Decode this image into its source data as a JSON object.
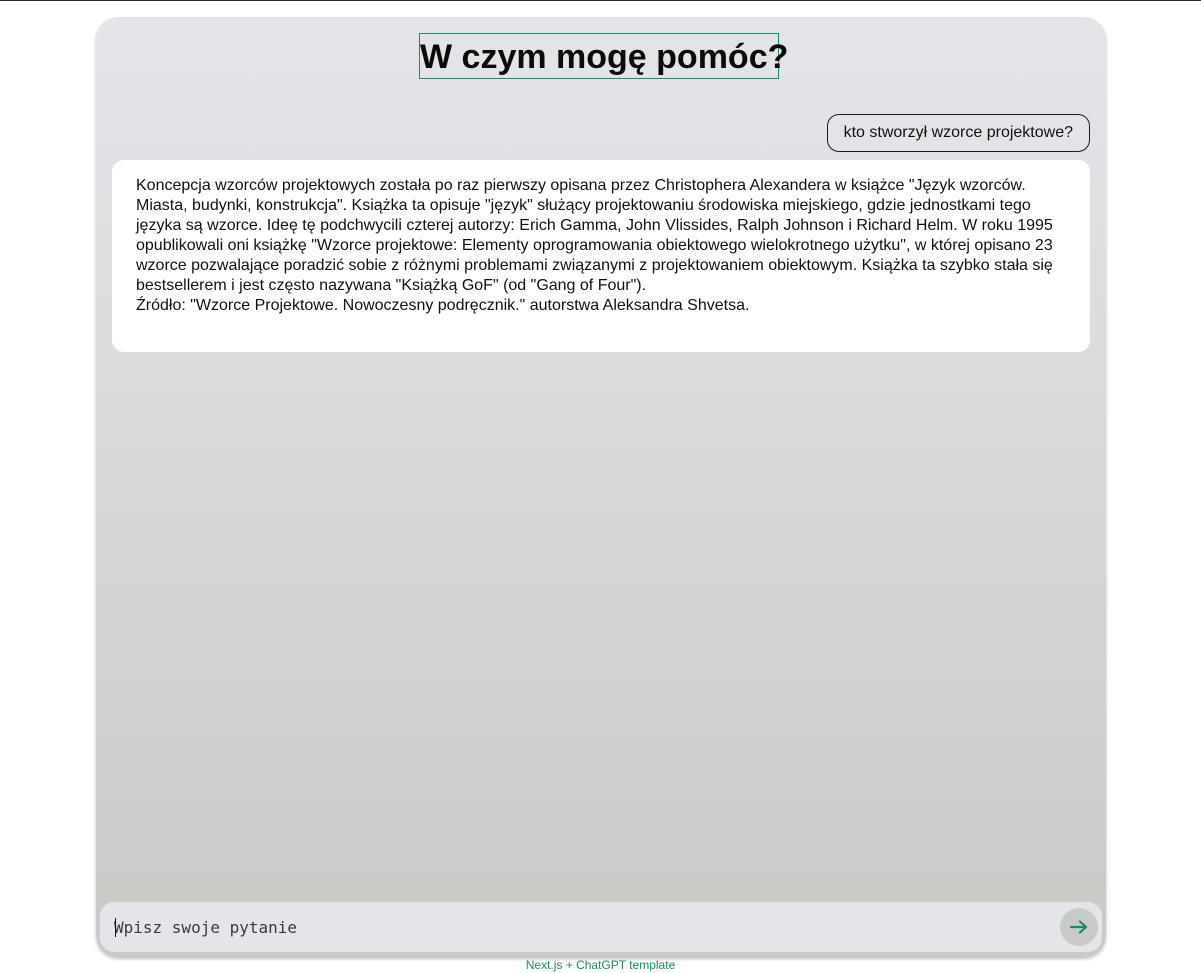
{
  "header": {
    "title": "W czym mogę pomóc?"
  },
  "conversation": {
    "user_message": "kto stworzył wzorce projektowe?",
    "assistant_message": {
      "paragraph": "Koncepcja wzorców projektowych została po raz pierwszy opisana przez Christophera Alexandera w książce \"Język wzorców. Miasta, budynki, konstrukcja\". Książka ta opisuje \"język\" służący projektowaniu środowiska miejskiego, gdzie jednostkami tego języka są wzorce. Ideę tę podchwycili czterej autorzy: Erich Gamma, John Vlissides, Ralph Johnson i Richard Helm. W roku 1995 opublikowali oni książkę \"Wzorce projektowe: Elementy oprogramowania obiektowego wielokrotnego użytku\", w której opisano 23 wzorce pozwalające poradzić sobie z różnymi problemami związanymi z projektowaniem obiektowym. Książka ta szybko stała się bestsellerem i jest często nazywana \"Książką GoF\" (od \"Gang of Four\").",
      "source": "Źródło: \"Wzorce Projektowe. Nowoczesny podręcznik.\" autorstwa Aleksandra Shvetsa."
    }
  },
  "input": {
    "placeholder": "Wpisz swoje pytanie",
    "value": ""
  },
  "send_button": {
    "icon": "arrow-right-icon",
    "color": "#1f8a5f"
  },
  "footer": {
    "text": "Next.js + ChatGPT template"
  },
  "colors": {
    "accent": "#1f8a70",
    "panel_top": "#e4e5e9",
    "panel_bottom": "#c9cac6"
  }
}
